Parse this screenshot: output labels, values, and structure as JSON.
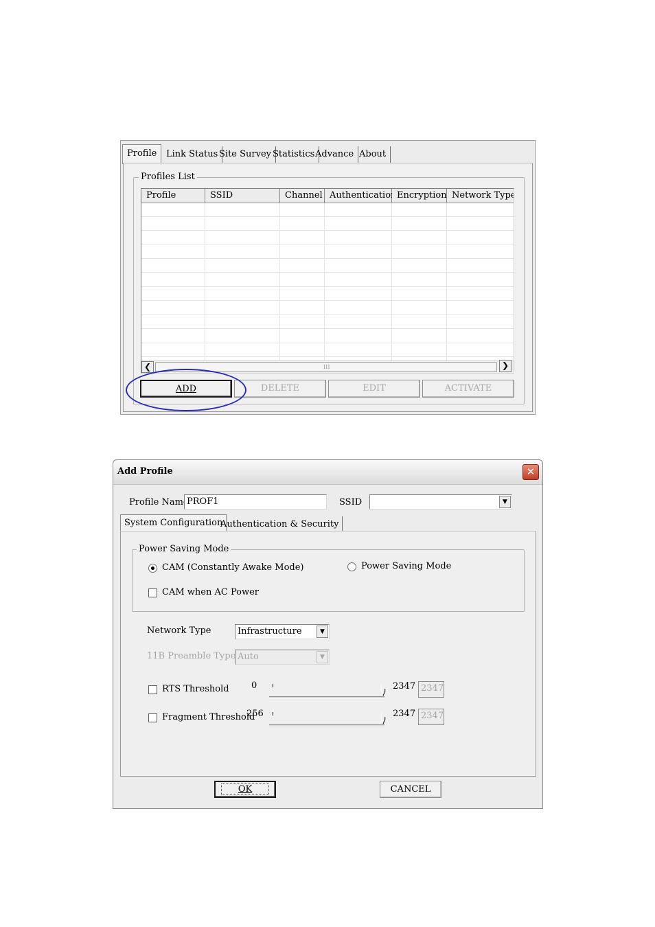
{
  "profile_panel": {
    "tabs": [
      "Profile",
      "Link Status",
      "Site Survey",
      "Statistics",
      "Advance",
      "About"
    ],
    "active_tab": "Profile",
    "group_label": "Profiles List",
    "columns": [
      "Profile",
      "SSID",
      "Channel",
      "Authentication",
      "Encryption",
      "Network Type"
    ],
    "rows": [],
    "scroll_grip": "III",
    "buttons": {
      "add": "ADD",
      "delete": "DELETE",
      "edit": "EDIT",
      "activate": "ACTIVATE"
    },
    "highlight_color": "#2b2bb5"
  },
  "add_profile_dialog": {
    "title": "Add Profile",
    "close_glyph": "✕",
    "profile_name_label": "Profile Name",
    "profile_name_value": "PROF1",
    "ssid_label": "SSID",
    "ssid_value": "",
    "tabs": [
      "System Configuration",
      "Authentication & Security"
    ],
    "active_tab": "System Configuration",
    "power_saving": {
      "group_label": "Power Saving Mode",
      "cam_label": "CAM (Constantly Awake Mode)",
      "psm_label": "Power Saving Mode",
      "cam_ac_label": "CAM when AC Power",
      "selected": "cam",
      "cam_ac_checked": false
    },
    "network_type_label": "Network Type",
    "network_type_value": "Infrastructure",
    "preamble_label": "11B Preamble Type",
    "preamble_value": "Auto",
    "rts": {
      "label": "RTS Threshold",
      "min": "0",
      "max": "2347",
      "value": "2347",
      "checked": false
    },
    "fragment": {
      "label": "Fragment Threshold",
      "min": "256",
      "max": "2347",
      "value": "2347",
      "checked": false
    },
    "ok_label": "OK",
    "cancel_label": "CANCEL"
  }
}
